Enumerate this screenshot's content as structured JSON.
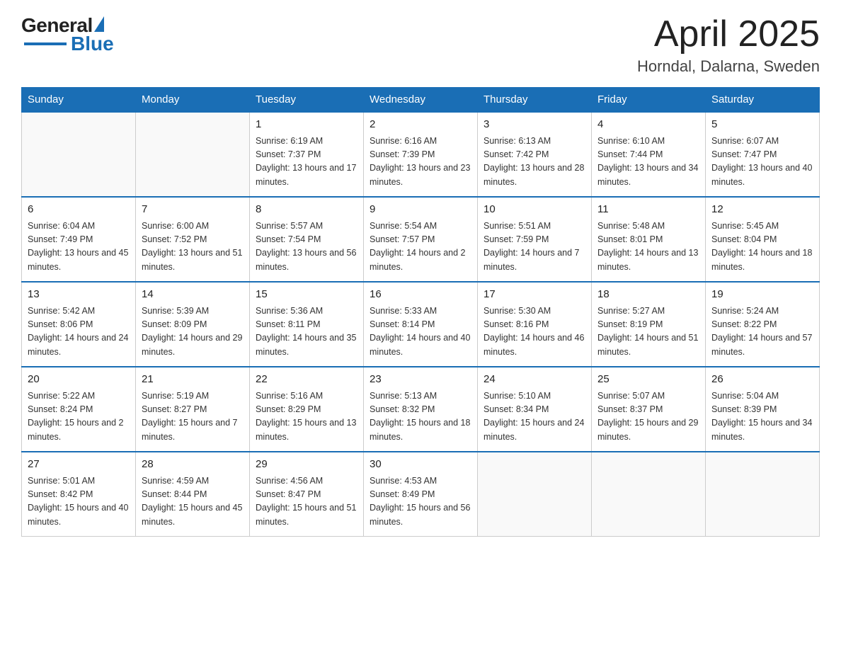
{
  "header": {
    "logo_general": "General",
    "logo_blue": "Blue",
    "title": "April 2025",
    "location": "Horndal, Dalarna, Sweden"
  },
  "weekdays": [
    "Sunday",
    "Monday",
    "Tuesday",
    "Wednesday",
    "Thursday",
    "Friday",
    "Saturday"
  ],
  "weeks": [
    [
      {
        "day": "",
        "sunrise": "",
        "sunset": "",
        "daylight": ""
      },
      {
        "day": "",
        "sunrise": "",
        "sunset": "",
        "daylight": ""
      },
      {
        "day": "1",
        "sunrise": "Sunrise: 6:19 AM",
        "sunset": "Sunset: 7:37 PM",
        "daylight": "Daylight: 13 hours and 17 minutes."
      },
      {
        "day": "2",
        "sunrise": "Sunrise: 6:16 AM",
        "sunset": "Sunset: 7:39 PM",
        "daylight": "Daylight: 13 hours and 23 minutes."
      },
      {
        "day": "3",
        "sunrise": "Sunrise: 6:13 AM",
        "sunset": "Sunset: 7:42 PM",
        "daylight": "Daylight: 13 hours and 28 minutes."
      },
      {
        "day": "4",
        "sunrise": "Sunrise: 6:10 AM",
        "sunset": "Sunset: 7:44 PM",
        "daylight": "Daylight: 13 hours and 34 minutes."
      },
      {
        "day": "5",
        "sunrise": "Sunrise: 6:07 AM",
        "sunset": "Sunset: 7:47 PM",
        "daylight": "Daylight: 13 hours and 40 minutes."
      }
    ],
    [
      {
        "day": "6",
        "sunrise": "Sunrise: 6:04 AM",
        "sunset": "Sunset: 7:49 PM",
        "daylight": "Daylight: 13 hours and 45 minutes."
      },
      {
        "day": "7",
        "sunrise": "Sunrise: 6:00 AM",
        "sunset": "Sunset: 7:52 PM",
        "daylight": "Daylight: 13 hours and 51 minutes."
      },
      {
        "day": "8",
        "sunrise": "Sunrise: 5:57 AM",
        "sunset": "Sunset: 7:54 PM",
        "daylight": "Daylight: 13 hours and 56 minutes."
      },
      {
        "day": "9",
        "sunrise": "Sunrise: 5:54 AM",
        "sunset": "Sunset: 7:57 PM",
        "daylight": "Daylight: 14 hours and 2 minutes."
      },
      {
        "day": "10",
        "sunrise": "Sunrise: 5:51 AM",
        "sunset": "Sunset: 7:59 PM",
        "daylight": "Daylight: 14 hours and 7 minutes."
      },
      {
        "day": "11",
        "sunrise": "Sunrise: 5:48 AM",
        "sunset": "Sunset: 8:01 PM",
        "daylight": "Daylight: 14 hours and 13 minutes."
      },
      {
        "day": "12",
        "sunrise": "Sunrise: 5:45 AM",
        "sunset": "Sunset: 8:04 PM",
        "daylight": "Daylight: 14 hours and 18 minutes."
      }
    ],
    [
      {
        "day": "13",
        "sunrise": "Sunrise: 5:42 AM",
        "sunset": "Sunset: 8:06 PM",
        "daylight": "Daylight: 14 hours and 24 minutes."
      },
      {
        "day": "14",
        "sunrise": "Sunrise: 5:39 AM",
        "sunset": "Sunset: 8:09 PM",
        "daylight": "Daylight: 14 hours and 29 minutes."
      },
      {
        "day": "15",
        "sunrise": "Sunrise: 5:36 AM",
        "sunset": "Sunset: 8:11 PM",
        "daylight": "Daylight: 14 hours and 35 minutes."
      },
      {
        "day": "16",
        "sunrise": "Sunrise: 5:33 AM",
        "sunset": "Sunset: 8:14 PM",
        "daylight": "Daylight: 14 hours and 40 minutes."
      },
      {
        "day": "17",
        "sunrise": "Sunrise: 5:30 AM",
        "sunset": "Sunset: 8:16 PM",
        "daylight": "Daylight: 14 hours and 46 minutes."
      },
      {
        "day": "18",
        "sunrise": "Sunrise: 5:27 AM",
        "sunset": "Sunset: 8:19 PM",
        "daylight": "Daylight: 14 hours and 51 minutes."
      },
      {
        "day": "19",
        "sunrise": "Sunrise: 5:24 AM",
        "sunset": "Sunset: 8:22 PM",
        "daylight": "Daylight: 14 hours and 57 minutes."
      }
    ],
    [
      {
        "day": "20",
        "sunrise": "Sunrise: 5:22 AM",
        "sunset": "Sunset: 8:24 PM",
        "daylight": "Daylight: 15 hours and 2 minutes."
      },
      {
        "day": "21",
        "sunrise": "Sunrise: 5:19 AM",
        "sunset": "Sunset: 8:27 PM",
        "daylight": "Daylight: 15 hours and 7 minutes."
      },
      {
        "day": "22",
        "sunrise": "Sunrise: 5:16 AM",
        "sunset": "Sunset: 8:29 PM",
        "daylight": "Daylight: 15 hours and 13 minutes."
      },
      {
        "day": "23",
        "sunrise": "Sunrise: 5:13 AM",
        "sunset": "Sunset: 8:32 PM",
        "daylight": "Daylight: 15 hours and 18 minutes."
      },
      {
        "day": "24",
        "sunrise": "Sunrise: 5:10 AM",
        "sunset": "Sunset: 8:34 PM",
        "daylight": "Daylight: 15 hours and 24 minutes."
      },
      {
        "day": "25",
        "sunrise": "Sunrise: 5:07 AM",
        "sunset": "Sunset: 8:37 PM",
        "daylight": "Daylight: 15 hours and 29 minutes."
      },
      {
        "day": "26",
        "sunrise": "Sunrise: 5:04 AM",
        "sunset": "Sunset: 8:39 PM",
        "daylight": "Daylight: 15 hours and 34 minutes."
      }
    ],
    [
      {
        "day": "27",
        "sunrise": "Sunrise: 5:01 AM",
        "sunset": "Sunset: 8:42 PM",
        "daylight": "Daylight: 15 hours and 40 minutes."
      },
      {
        "day": "28",
        "sunrise": "Sunrise: 4:59 AM",
        "sunset": "Sunset: 8:44 PM",
        "daylight": "Daylight: 15 hours and 45 minutes."
      },
      {
        "day": "29",
        "sunrise": "Sunrise: 4:56 AM",
        "sunset": "Sunset: 8:47 PM",
        "daylight": "Daylight: 15 hours and 51 minutes."
      },
      {
        "day": "30",
        "sunrise": "Sunrise: 4:53 AM",
        "sunset": "Sunset: 8:49 PM",
        "daylight": "Daylight: 15 hours and 56 minutes."
      },
      {
        "day": "",
        "sunrise": "",
        "sunset": "",
        "daylight": ""
      },
      {
        "day": "",
        "sunrise": "",
        "sunset": "",
        "daylight": ""
      },
      {
        "day": "",
        "sunrise": "",
        "sunset": "",
        "daylight": ""
      }
    ]
  ]
}
